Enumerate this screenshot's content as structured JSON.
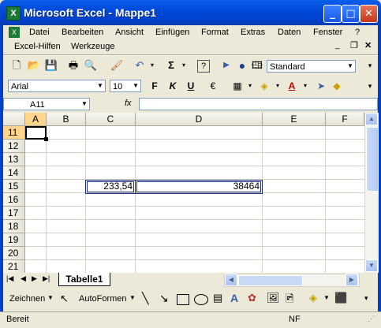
{
  "window": {
    "title": "Microsoft Excel - Mappe1"
  },
  "menu": [
    "Datei",
    "Bearbeiten",
    "Ansicht",
    "Einfügen",
    "Format",
    "Extras",
    "Daten",
    "Fenster",
    "?"
  ],
  "menu2": [
    "Excel-Hilfen",
    "Werkzeuge"
  ],
  "toolbar": {
    "style_combo": "Standard",
    "font": "Arial",
    "size": "10",
    "bold": "F",
    "italic": "K",
    "underline": "U"
  },
  "formula": {
    "name_box": "A11",
    "fx": "fx",
    "value": ""
  },
  "grid": {
    "columns": [
      "A",
      "B",
      "C",
      "D",
      "E",
      "F"
    ],
    "rows": [
      "11",
      "12",
      "13",
      "14",
      "15",
      "16",
      "17",
      "18",
      "19",
      "20",
      "21"
    ],
    "cells": {
      "C15": "233,54",
      "D15": "38464"
    }
  },
  "sheet_tabs": [
    "Tabelle1"
  ],
  "drawing": {
    "zeichnen": "Zeichnen",
    "autoformen": "AutoFormen"
  },
  "status": {
    "left": "Bereit",
    "nf": "NF"
  },
  "colors": {
    "titlebar": "#0A5FEA",
    "excel_green": "#1D7A36",
    "chrome": "#ECE9D8"
  }
}
